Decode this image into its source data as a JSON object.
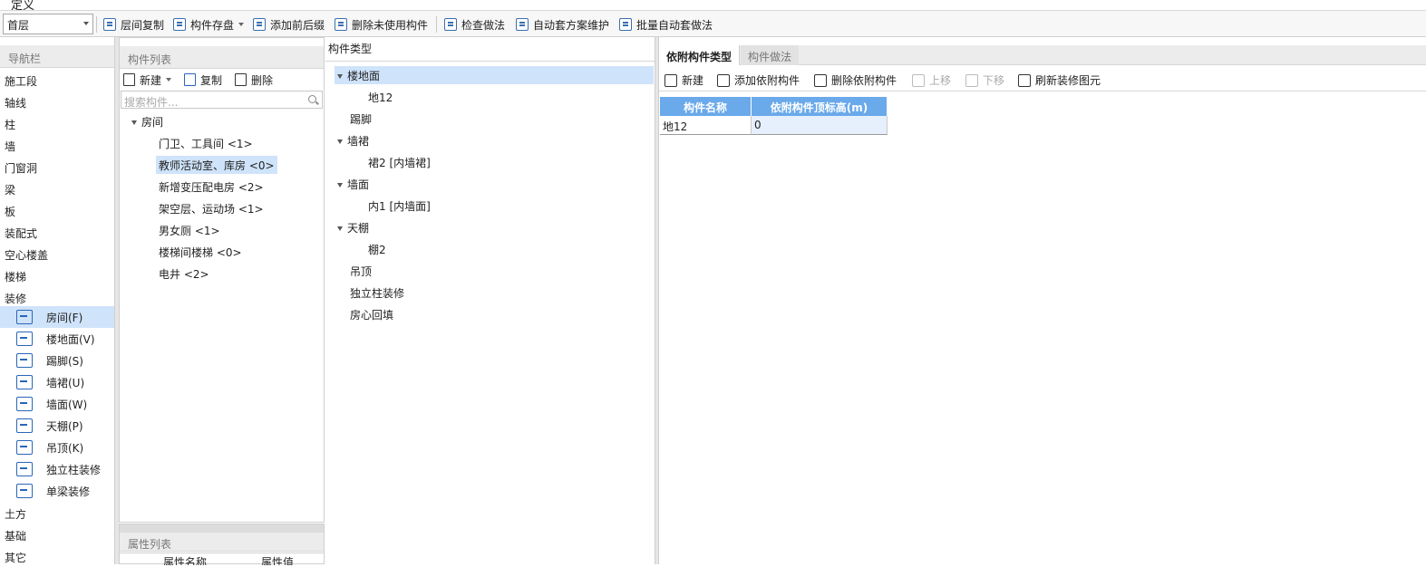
{
  "window": {
    "title": "定义"
  },
  "toolbar": {
    "floor_select": "首层",
    "items": [
      "层间复制",
      "构件存盘",
      "添加前后缀",
      "删除未使用构件",
      "检查做法",
      "自动套方案维护",
      "批量自动套做法"
    ]
  },
  "nav": {
    "header": "导航栏",
    "items": [
      "施工段",
      "轴线",
      "柱",
      "墙",
      "门窗洞",
      "梁",
      "板",
      "装配式",
      "空心楼盖",
      "楼梯",
      "装修"
    ],
    "sub_items": [
      "房间(F)",
      "楼地面(V)",
      "踢脚(S)",
      "墙裙(U)",
      "墙面(W)",
      "天棚(P)",
      "吊顶(K)",
      "独立柱装修",
      "单梁装修"
    ],
    "items_after": [
      "土方",
      "基础",
      "其它"
    ]
  },
  "component_list": {
    "header": "构件列表",
    "new_label": "新建",
    "copy_label": "复制",
    "delete_label": "删除",
    "search_placeholder": "搜索构件...",
    "root": "房间",
    "children": [
      "门卫、工具间 <1>",
      "教师活动室、库房 <0>",
      "新增变压配电房 <2>",
      "架空层、运动场 <1>",
      "男女厕 <1>",
      "楼梯间楼梯 <0>",
      "电井 <2>"
    ],
    "selected_index": 1
  },
  "properties": {
    "header": "属性列表",
    "col_name": "属性名称",
    "col_value": "属性值"
  },
  "component_type": {
    "header": "构件类型",
    "tree": [
      {
        "label": "楼地面",
        "expanded": true,
        "children": [
          "地12"
        ]
      },
      {
        "label": "踢脚",
        "expanded": false,
        "children": []
      },
      {
        "label": "墙裙",
        "expanded": true,
        "children": [
          "裙2 [内墙裙]"
        ]
      },
      {
        "label": "墙面",
        "expanded": true,
        "children": [
          "内1 [内墙面]"
        ]
      },
      {
        "label": "天棚",
        "expanded": true,
        "children": [
          "棚2"
        ]
      },
      {
        "label": "吊顶",
        "expanded": false,
        "children": []
      },
      {
        "label": "独立柱装修",
        "expanded": false,
        "children": []
      },
      {
        "label": "房心回填",
        "expanded": false,
        "children": []
      }
    ]
  },
  "right_panel": {
    "tabs": [
      "依附构件类型",
      "构件做法"
    ],
    "actions": [
      "新建",
      "添加依附构件",
      "删除依附构件",
      "上移",
      "下移",
      "刷新装修图元"
    ],
    "table": {
      "headers": [
        "构件名称",
        "依附构件顶标高(m)"
      ],
      "rows": [
        [
          "地12",
          "0"
        ]
      ]
    }
  },
  "colors": {
    "selection": "#cfe3fa",
    "grid_header": "#6aa9ea",
    "icon_blue": "#2a66b8"
  }
}
